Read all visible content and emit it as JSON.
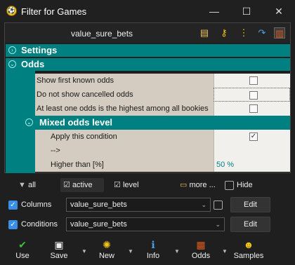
{
  "window": {
    "title": "Filter for Games"
  },
  "toolbar": {
    "name": "value_sure_bets"
  },
  "tree": {
    "settings_label": "Settings",
    "odds_label": "Odds",
    "odds_rows": [
      {
        "label": "Show first known odds",
        "checked": false
      },
      {
        "label": "Do not show cancelled odds",
        "checked": false
      },
      {
        "label": "At least one odds is the highest among all bookies",
        "checked": false
      }
    ],
    "mixed_label": "Mixed odds level",
    "mixed_rows": [
      {
        "label": "Apply this condition",
        "value": "✓"
      },
      {
        "label": "-->",
        "value": ""
      },
      {
        "label": "Higher than [%]",
        "value": "50 %"
      }
    ]
  },
  "filterbar": {
    "all": "all",
    "active": "active",
    "level": "level",
    "more": "more ...",
    "hide": "Hide"
  },
  "columns": {
    "label": "Columns",
    "value": "value_sure_bets",
    "edit": "Edit"
  },
  "conditions": {
    "label": "Conditions",
    "value": "value_sure_bets",
    "edit": "Edit"
  },
  "bottom": {
    "use": "Use",
    "save": "Save",
    "new": "New",
    "info": "Info",
    "odds": "Odds",
    "samples": "Samples"
  },
  "colors": {
    "teal": "#008080",
    "row_bg": "#d4ccc0",
    "accent": "#3a8ee6"
  }
}
